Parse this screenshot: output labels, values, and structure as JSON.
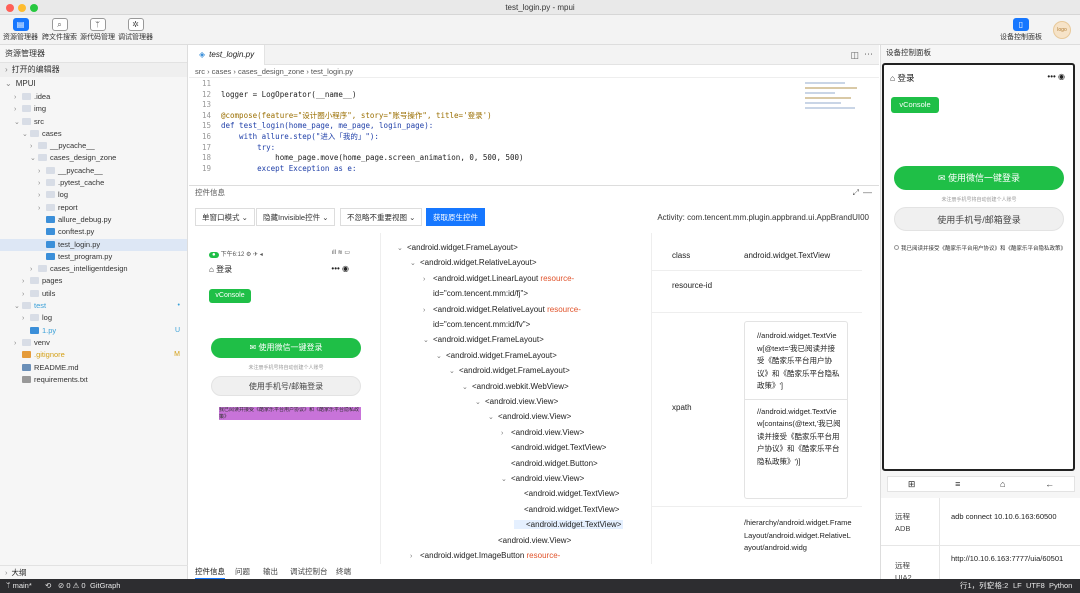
{
  "window": {
    "title": "test_login.py - mpui"
  },
  "toolbar": {
    "buttons": [
      {
        "label": "资源管理器",
        "icon": "files-icon"
      },
      {
        "label": "跨文件搜索",
        "icon": "search-icon"
      },
      {
        "label": "源代码管理",
        "icon": "git-branch-icon"
      },
      {
        "label": "调试管理器",
        "icon": "bug-icon"
      }
    ],
    "device_panel_label": "设备控制面板",
    "avatar_text": "logo"
  },
  "sidebar": {
    "title": "资源管理器",
    "open_editors": "打开的编辑器",
    "project": "MPUI",
    "tree": [
      {
        "label": ".idea",
        "depth": 1,
        "type": "folder",
        "arrow": "›"
      },
      {
        "label": "img",
        "depth": 1,
        "type": "folder",
        "arrow": "›"
      },
      {
        "label": "src",
        "depth": 1,
        "type": "folder",
        "arrow": "⌄"
      },
      {
        "label": "cases",
        "depth": 2,
        "type": "folder",
        "arrow": "⌄"
      },
      {
        "label": "__pycache__",
        "depth": 3,
        "type": "folder",
        "arrow": "›"
      },
      {
        "label": "cases_design_zone",
        "depth": 3,
        "type": "folder",
        "arrow": "⌄"
      },
      {
        "label": "__pycache__",
        "depth": 4,
        "type": "folder",
        "arrow": "›"
      },
      {
        "label": ".pytest_cache",
        "depth": 4,
        "type": "folder",
        "arrow": "›"
      },
      {
        "label": "log",
        "depth": 4,
        "type": "folder",
        "arrow": "›"
      },
      {
        "label": "report",
        "depth": 4,
        "type": "folder",
        "arrow": "›"
      },
      {
        "label": "allure_debug.py",
        "depth": 4,
        "type": "py",
        "arrow": ""
      },
      {
        "label": "conftest.py",
        "depth": 4,
        "type": "py",
        "arrow": ""
      },
      {
        "label": "test_login.py",
        "depth": 4,
        "type": "py",
        "arrow": "",
        "selected": true
      },
      {
        "label": "test_program.py",
        "depth": 4,
        "type": "py",
        "arrow": ""
      },
      {
        "label": "cases_intelligentdesign",
        "depth": 3,
        "type": "folder",
        "arrow": "›"
      },
      {
        "label": "pages",
        "depth": 2,
        "type": "folder",
        "arrow": "›"
      },
      {
        "label": "utils",
        "depth": 2,
        "type": "folder",
        "arrow": "›"
      },
      {
        "label": "test",
        "depth": 1,
        "type": "folder",
        "arrow": "⌄",
        "color": "#3aa0d8",
        "badge": "•"
      },
      {
        "label": "log",
        "depth": 2,
        "type": "folder",
        "arrow": "›"
      },
      {
        "label": "1.py",
        "depth": 2,
        "type": "py",
        "arrow": "",
        "color": "#3aa0d8",
        "badge": "U"
      },
      {
        "label": "venv",
        "depth": 1,
        "type": "folder",
        "arrow": "›"
      },
      {
        "label": ".gitignore",
        "depth": 1,
        "type": "git",
        "arrow": "",
        "color": "#d4a017",
        "badge": "M"
      },
      {
        "label": "README.md",
        "depth": 1,
        "type": "md",
        "arrow": ""
      },
      {
        "label": "requirements.txt",
        "depth": 1,
        "type": "txt",
        "arrow": ""
      }
    ],
    "outline": "大纲"
  },
  "editor": {
    "tab": "test_login.py",
    "breadcrumb": [
      "src",
      "cases",
      "cases_design_zone",
      "test_login.py"
    ],
    "lines": [
      {
        "n": "11",
        "code": ""
      },
      {
        "n": "12",
        "code": "logger = LogOperator(__name__)"
      },
      {
        "n": "13",
        "code": ""
      },
      {
        "n": "14",
        "code": "@compose(feature=\"设计圈小程序\", story=\"账号操作\", title='登录')"
      },
      {
        "n": "15",
        "code": "def test_login(home_page, me_page, login_page):"
      },
      {
        "n": "16",
        "code": "    with allure.step(\"进入「我的」\"):"
      },
      {
        "n": "17",
        "code": "        try:"
      },
      {
        "n": "18",
        "code": "            home_page.move(home_page.screen_animation, 0, 500, 500)"
      },
      {
        "n": "19",
        "code": "        except Exception as e:"
      }
    ]
  },
  "panel": {
    "title": "控件信息",
    "modes": [
      "单窗口模式",
      "隐藏Invisible控件",
      "不忽略不重要视图"
    ],
    "primary": "获取原生控件",
    "activity": "Activity: com.tencent.mm.plugin.appbrand.ui.AppBrandUI00",
    "tabs": [
      "控件信息",
      "问题",
      "输出",
      "调试控制台",
      "终端"
    ]
  },
  "phone_preview": {
    "status_time": "下午6:12",
    "title": "登录",
    "vconsole": "vConsole",
    "wechat_login": "使用微信一键登录",
    "hint": "未注册手机号将自动创建个人账号",
    "phone_login": "使用手机号/邮箱登录",
    "agreement": "我已阅读并接受《酷家乐平台用户协议》和《酷家乐平台隐私政策》"
  },
  "xml_tree": [
    {
      "depth": 0,
      "arrow": "⌄",
      "text": "<android.widget.FrameLayout>"
    },
    {
      "depth": 1,
      "arrow": "⌄",
      "text": "<android.widget.RelativeLayout>"
    },
    {
      "depth": 2,
      "arrow": "›",
      "text": "<android.widget.LinearLayout ",
      "rid": "resource-",
      "cont": "id=\"com.tencent.mm:id/fj\">"
    },
    {
      "depth": 2,
      "arrow": "›",
      "text": "<android.widget.RelativeLayout ",
      "rid": "resource-",
      "cont": "id=\"com.tencent.mm:id/fv\">"
    },
    {
      "depth": 2,
      "arrow": "⌄",
      "text": "<android.widget.FrameLayout>"
    },
    {
      "depth": 3,
      "arrow": "⌄",
      "text": "<android.widget.FrameLayout>"
    },
    {
      "depth": 4,
      "arrow": "⌄",
      "text": "<android.widget.FrameLayout>"
    },
    {
      "depth": 5,
      "arrow": "⌄",
      "text": "<android.webkit.WebView>"
    },
    {
      "depth": 6,
      "arrow": "⌄",
      "text": "<android.view.View>"
    },
    {
      "depth": 7,
      "arrow": "⌄",
      "text": "<android.view.View>"
    },
    {
      "depth": 8,
      "arrow": "›",
      "text": "<android.view.View>"
    },
    {
      "depth": 8,
      "arrow": "",
      "text": "<android.widget.TextView>"
    },
    {
      "depth": 8,
      "arrow": "",
      "text": "<android.widget.Button>"
    },
    {
      "depth": 8,
      "arrow": "⌄",
      "text": "<android.view.View>"
    },
    {
      "depth": 9,
      "arrow": "",
      "text": "<android.widget.TextView>"
    },
    {
      "depth": 9,
      "arrow": "",
      "text": "<android.widget.TextView>"
    },
    {
      "depth": 9,
      "arrow": "",
      "text": "<android.widget.TextView>",
      "selected": true
    },
    {
      "depth": 7,
      "arrow": "",
      "text": "<android.view.View>"
    },
    {
      "depth": 1,
      "arrow": "›",
      "text": "<android.widget.ImageButton ",
      "rid": "resource-"
    }
  ],
  "attributes": [
    {
      "key": "class",
      "value": "android.widget.TextView"
    },
    {
      "key": "resource-id",
      "value": ""
    },
    {
      "key": "xpath",
      "value": "",
      "values": [
        "//android.widget.TextView[@text='我已阅读并接受《酷家乐平台用户协议》和《酷家乐平台隐私政策》']",
        "//android.widget.TextView[contains(@text,'我已阅读并接受《酷家乐平台用户协议》和《酷家乐平台隐私政策》')]"
      ]
    },
    {
      "key": "",
      "value": "/hierarchy/android.widget.FrameLayout/android.widget.RelativeLayout/android.widg"
    }
  ],
  "device_panel": {
    "title": "设备控制面板",
    "screen": {
      "title": "登录",
      "vconsole": "vConsole",
      "wechat_login": "使用微信一键登录",
      "hint": "未注册手机号将自动创建个人账号",
      "phone_login": "使用手机号/邮箱登录",
      "agreement": "我已阅读并接受《酷家乐平台用户协议》和《酷家乐平台隐私政策》"
    },
    "nav_icons": [
      "grid-icon",
      "menu-icon",
      "home-icon",
      "back-icon"
    ],
    "remote": [
      {
        "label": "远程ADB",
        "value": "adb connect 10.10.6.163:60500"
      },
      {
        "label": "远程UIA2",
        "value": "http://10.10.6.163:7777/uia/60501"
      }
    ]
  },
  "statusbar": {
    "branch": "main*",
    "sync": "⟲",
    "problems": "⊘ 0 ⚠ 0",
    "gitgraph": "GitGraph",
    "position": "行1，列1",
    "spaces": "空格:2",
    "eol": "LF",
    "encoding": "UTF8",
    "language": "Python"
  },
  "colors": {
    "accent": "#1677ff",
    "wechat_green": "#1fbf47",
    "resource_id": "#e0522a",
    "statusbar": "#2d2d30"
  }
}
